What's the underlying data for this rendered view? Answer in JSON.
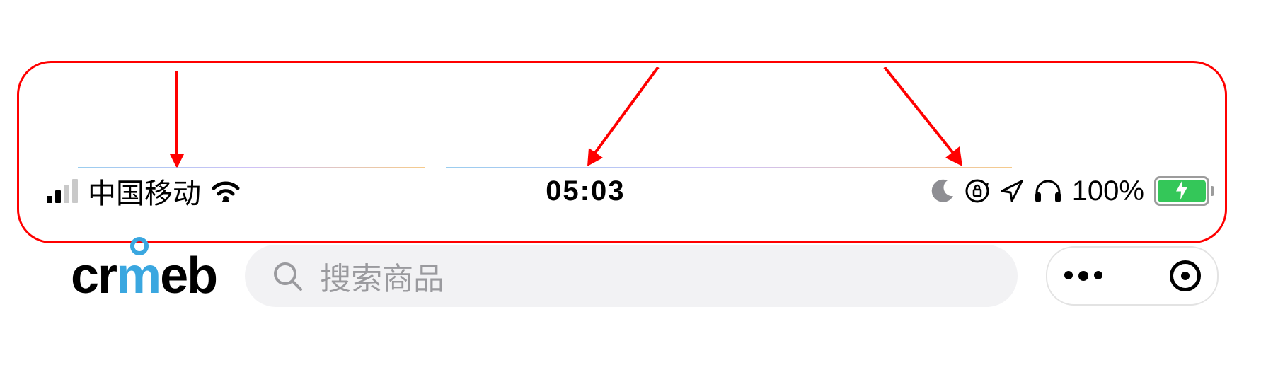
{
  "status_bar": {
    "carrier": "中国移动",
    "time": "05:03",
    "battery_percent": "100%"
  },
  "header": {
    "logo_text_pre": "cr",
    "logo_text_m": "m",
    "logo_text_post": "eb",
    "search_placeholder": "搜索商品"
  },
  "icons": {
    "signal": "signal-icon",
    "wifi": "wifi-icon",
    "moon": "moon-icon",
    "rotation_lock": "rotation-lock-icon",
    "location": "location-icon",
    "headphones": "headphones-icon",
    "battery": "battery-charging-icon",
    "search": "search-icon",
    "menu_dots": "menu-dots-icon",
    "target": "target-icon"
  }
}
